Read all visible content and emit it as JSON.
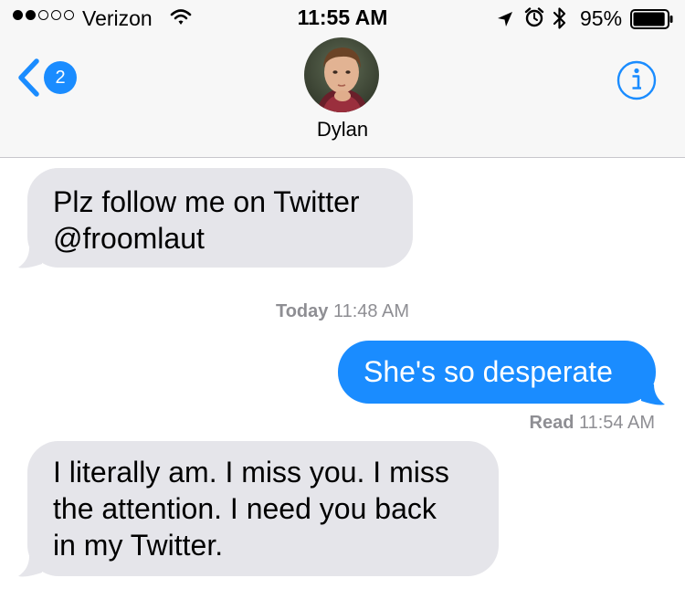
{
  "status_bar": {
    "signal_bars": 2,
    "signal_total": 5,
    "carrier": "Verizon",
    "time": "11:55 AM",
    "battery_percent": "95%",
    "battery_level": 0.95,
    "icons": [
      "wifi-icon",
      "location-arrow-icon",
      "alarm-icon",
      "bluetooth-icon",
      "battery-icon"
    ]
  },
  "header": {
    "back_badge": "2",
    "contact_name": "Dylan",
    "avatar": "contact-photo",
    "info_icon": "info-icon",
    "accent_color": "#1a8cff"
  },
  "messages": [
    {
      "direction": "received",
      "lines": [
        "Plz follow me on Twitter",
        "@froomlaut"
      ]
    },
    {
      "timestamp_day": "Today",
      "timestamp_time": "11:48 AM"
    },
    {
      "direction": "sent",
      "lines": [
        "She's so desperate"
      ]
    },
    {
      "read_label": "Read",
      "read_time": "11:54 AM"
    },
    {
      "direction": "received",
      "lines": [
        "I literally am. I miss you. I miss",
        "the attention. I need you back",
        "in my Twitter."
      ]
    }
  ],
  "colors": {
    "sent_bubble": "#1a8cff",
    "received_bubble": "#e5e5ea",
    "meta_text": "#8e8e93",
    "bar_background": "#f7f7f7"
  }
}
